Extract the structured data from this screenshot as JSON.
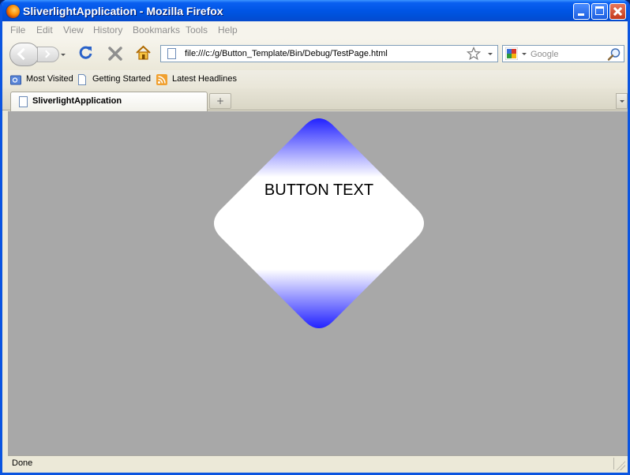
{
  "window": {
    "title": "SliverlightApplication - Mozilla Firefox"
  },
  "menu": {
    "items": [
      "File",
      "Edit",
      "View",
      "History",
      "Bookmarks",
      "Tools",
      "Help"
    ]
  },
  "navigation": {
    "url": "file:///c:/g/Button_Template/Bin/Debug/TestPage.html",
    "search_placeholder": "Google"
  },
  "bookmarks": {
    "items": [
      "Most Visited",
      "Getting Started",
      "Latest Headlines"
    ]
  },
  "tabs": {
    "active_label": "SliverlightApplication"
  },
  "content": {
    "button_text": "BUTTON TEXT",
    "background_color": "#a8a8a8",
    "button_gradient_colors": [
      "#2222ff",
      "#ffffff",
      "#ffffff",
      "#2222ff"
    ]
  },
  "status": {
    "text": "Done"
  }
}
